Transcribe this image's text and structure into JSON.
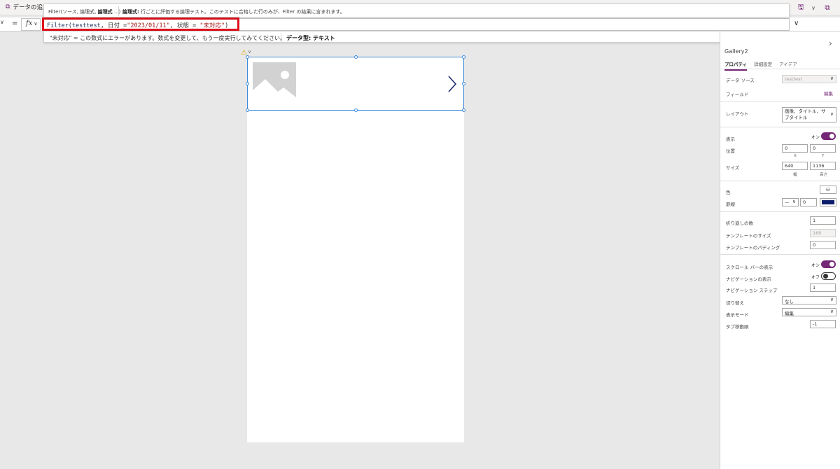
{
  "topbar": {
    "app_title": "データの追加",
    "app_icon": "app-icon",
    "right_icons": [
      "save-icon",
      "dropdown-icon",
      "share-icon"
    ]
  },
  "formula_bar": {
    "equals": "=",
    "fx_label": "fx",
    "formula_parts": {
      "fn": "Filter(",
      "source": "testtest",
      "sep1": ", ",
      "field1": "日付",
      "op1": " =",
      "val1": "\"2023/01/11\"",
      "sep2": ", ",
      "field2": "状態",
      "op2": " = ",
      "val2": "\"未対応\"",
      "close": ")"
    }
  },
  "hint_top": {
    "signature_prefix": "Filter(ソース, 論理式, ",
    "signature_bold": "論理式",
    "signature_suffix": " ...)",
    "desc_bold": "論理式:",
    "desc_text": " 行ごとに評価する論理テスト。このテストに合格した行のみが、Filter の結果に含まれます。"
  },
  "hint_bottom": {
    "error_text": "\"未対応\" = この数式にエラーがあります。数式を変更して、もう一度実行してみてください。",
    "dtype_label": "データ型: ",
    "dtype_value": "テキスト"
  },
  "panel": {
    "control_name": "Gallery2",
    "tabs": [
      "プロパティ",
      "詳細設定",
      "アイデア"
    ],
    "data_source_label": "データ ソース",
    "data_source_value": "testtest",
    "fields_label": "フィールド",
    "fields_link": "編集",
    "layout_label": "レイアウト",
    "layout_value": "画像、タイトル、サブタイトル",
    "visible_label": "表示",
    "visible_state": "オン",
    "position_label": "位置",
    "position_x": "0",
    "position_y": "0",
    "x_label": "X",
    "y_label": "Y",
    "size_label": "サイズ",
    "size_w": "640",
    "size_h": "1136",
    "w_label": "幅",
    "h_label": "高さ",
    "color_label": "色",
    "border_label": "罫線",
    "border_width": "0",
    "border_color": "#0b1d6b",
    "wrap_label": "折り返しの数",
    "wrap_value": "1",
    "template_size_label": "テンプレートのサイズ",
    "template_size_value": "160",
    "template_padding_label": "テンプレートのパディング",
    "template_padding_value": "0",
    "scrollbar_label": "スクロール バーの表示",
    "scrollbar_state": "オン",
    "nav_label": "ナビゲーションの表示",
    "nav_state": "オフ",
    "nav_step_label": "ナビゲーション ステップ",
    "nav_step_value": "1",
    "transition_label": "切り替え",
    "transition_value": "なし",
    "display_mode_label": "表示モード",
    "display_mode_value": "編集",
    "tab_index_label": "タブ移動順",
    "tab_index_value": "-1"
  }
}
